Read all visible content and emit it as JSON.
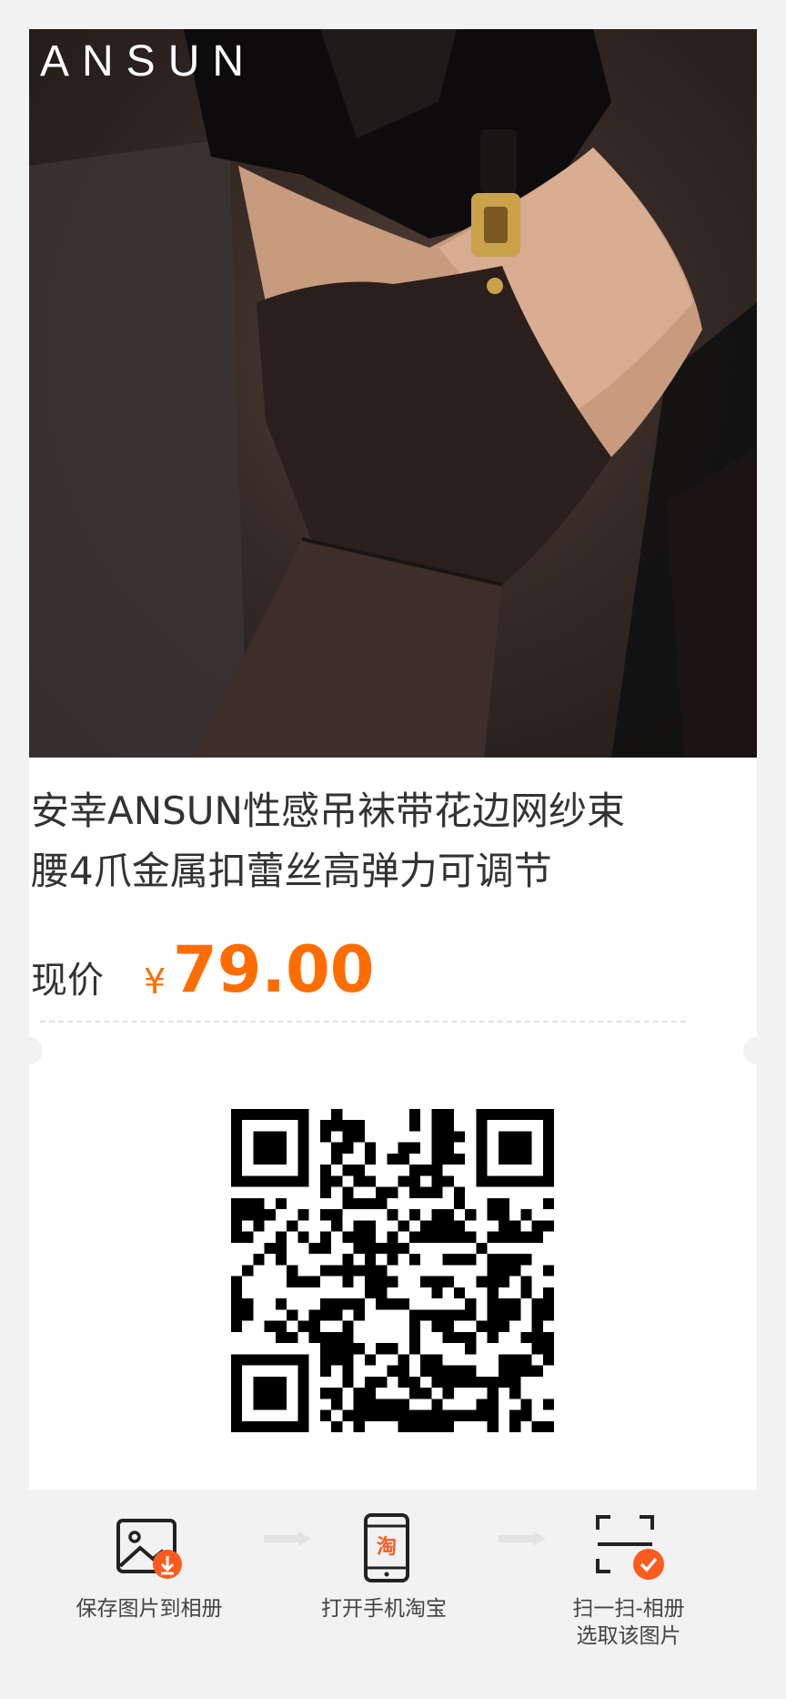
{
  "brand": "ANSUN",
  "product": {
    "title_line1": "安幸ANSUN性感吊袜带花边网纱束",
    "title_line2": "腰4爪金属扣蕾丝高弹力可调节",
    "price_label": "现价",
    "currency": "¥",
    "price": "79.00"
  },
  "colors": {
    "accent": "#ff6d00",
    "background": "#f2f2f2",
    "card": "#ffffff",
    "text": "#333333"
  },
  "steps": [
    {
      "label": "保存图片到相册",
      "icon": "image-download-icon"
    },
    {
      "label": "打开手机淘宝",
      "icon": "phone-taobao-icon",
      "badge": "淘"
    },
    {
      "label_line1": "扫一扫-相册",
      "label_line2": "选取该图片",
      "icon": "scan-check-icon"
    }
  ]
}
